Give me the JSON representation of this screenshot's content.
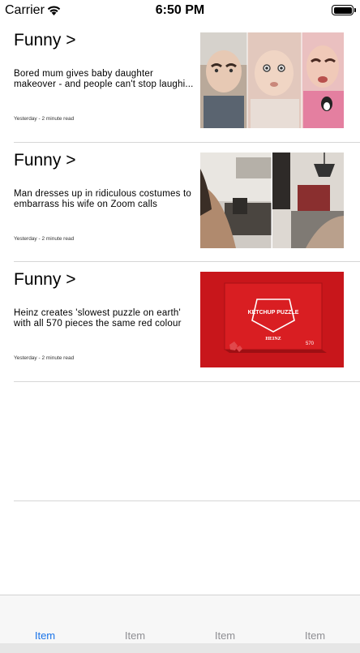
{
  "status_bar": {
    "carrier": "Carrier",
    "time": "6:50 PM"
  },
  "articles": [
    {
      "category": "Funny >",
      "title": "Bored mum gives baby daughter makeover - and people can't stop laughi...",
      "meta": "Yesterday - 2 minute read",
      "image": "baby-makeover-photo"
    },
    {
      "category": "Funny >",
      "title": "Man dresses up in ridiculous costumes to embarrass his wife on Zoom calls",
      "meta": "Yesterday - 2 minute read",
      "image": "zoom-costume-photo"
    },
    {
      "category": "Funny >",
      "title": "Heinz creates 'slowest puzzle on earth' with all 570 pieces the same red colour",
      "meta": "Yesterday - 2 minute read",
      "image": "ketchup-puzzle-photo",
      "image_text": {
        "box_title": "KETCHUP PUZZLE",
        "brand": "HEINZ",
        "count": "570"
      }
    }
  ],
  "tab_bar": {
    "tabs": [
      {
        "label": "Item",
        "active": true
      },
      {
        "label": "Item",
        "active": false
      },
      {
        "label": "Item",
        "active": false
      },
      {
        "label": "Item",
        "active": false
      }
    ]
  },
  "colors": {
    "active_tab": "#1a73e8",
    "inactive_tab": "#8e8e93",
    "separator": "#d6d6d6",
    "puzzle_red": "#c8161b"
  }
}
